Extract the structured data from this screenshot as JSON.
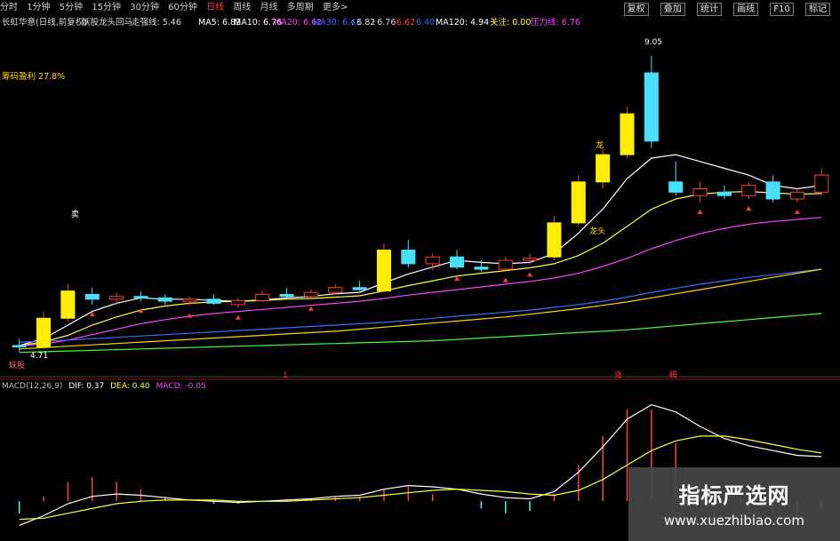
{
  "toolbar": {
    "periods": [
      "分时",
      "1分钟",
      "5分钟",
      "15分钟",
      "30分钟",
      "60分钟",
      "日线",
      "周线",
      "月线",
      "多周期",
      "更多>"
    ],
    "active": "日线",
    "buttons": [
      "复权",
      "叠加",
      "统计",
      "画线",
      "F10",
      "标记"
    ]
  },
  "info": {
    "stock": "长虹华意(日线,前复权)",
    "indicator": "妖股龙头回马",
    "lock_label": "走强线: 5.46",
    "ma5": "MA5: 6.82",
    "ma10": "MA10: 6.76",
    "ma20": "MA20: 6.62",
    "ma30": "MA30: 6.43",
    "ma_val1": ": 6.82",
    "ma_val2": ": 6.76",
    "ma_val3": "6.62",
    "ma_val4": "6.40",
    "ma120": "MA120: 4.94",
    "attention": "关注: 0.00",
    "pressure": "压力线: 6.76"
  },
  "overlay": {
    "profit": "筹码盈利 27.8%",
    "high_label": "9.05",
    "low_label": "4.71",
    "start_label": "妖股",
    "dragon1": "龙",
    "dragon2": "龙头",
    "mark_a": "涨",
    "mark_b": "腾",
    "mark_c": "1",
    "sell": "卖"
  },
  "macd": {
    "title": "MACD(12,26,9)",
    "dif": "DIF: 0.37",
    "dea": "DEA: 0.40",
    "macd": "MACD: -0.05"
  },
  "watermark": {
    "cn": "指标严选网",
    "en": "www.xuezhibiao.com"
  },
  "colors": {
    "up": "#ff3c3c",
    "down": "#49e0ff",
    "ma5": "#ffffff",
    "ma10": "#ffff40",
    "ma20": "#ff40ff",
    "ma30": "#40ff40",
    "ma60": "#3c6cff",
    "ma120": "#ffd700"
  },
  "chart_data": {
    "type": "candlestick",
    "candles": [
      {
        "o": 4.8,
        "h": 4.9,
        "l": 4.71,
        "c": 4.78
      },
      {
        "o": 4.78,
        "h": 5.3,
        "l": 4.75,
        "c": 5.2
      },
      {
        "o": 5.2,
        "h": 5.7,
        "l": 5.15,
        "c": 5.6
      },
      {
        "o": 5.55,
        "h": 5.65,
        "l": 5.4,
        "c": 5.48
      },
      {
        "o": 5.48,
        "h": 5.58,
        "l": 5.4,
        "c": 5.52
      },
      {
        "o": 5.52,
        "h": 5.6,
        "l": 5.45,
        "c": 5.5
      },
      {
        "o": 5.5,
        "h": 5.55,
        "l": 5.4,
        "c": 5.45
      },
      {
        "o": 5.45,
        "h": 5.52,
        "l": 5.38,
        "c": 5.48
      },
      {
        "o": 5.48,
        "h": 5.55,
        "l": 5.4,
        "c": 5.42
      },
      {
        "o": 5.4,
        "h": 5.5,
        "l": 5.35,
        "c": 5.46
      },
      {
        "o": 5.46,
        "h": 5.6,
        "l": 5.44,
        "c": 5.55
      },
      {
        "o": 5.55,
        "h": 5.65,
        "l": 5.5,
        "c": 5.52
      },
      {
        "o": 5.52,
        "h": 5.62,
        "l": 5.48,
        "c": 5.58
      },
      {
        "o": 5.58,
        "h": 5.7,
        "l": 5.55,
        "c": 5.65
      },
      {
        "o": 5.65,
        "h": 5.75,
        "l": 5.6,
        "c": 5.62
      },
      {
        "o": 5.6,
        "h": 6.3,
        "l": 5.58,
        "c": 6.2
      },
      {
        "o": 6.2,
        "h": 6.35,
        "l": 5.95,
        "c": 6.0
      },
      {
        "o": 6.0,
        "h": 6.15,
        "l": 5.9,
        "c": 6.1
      },
      {
        "o": 6.1,
        "h": 6.2,
        "l": 5.92,
        "c": 5.95
      },
      {
        "o": 5.95,
        "h": 6.05,
        "l": 5.88,
        "c": 5.92
      },
      {
        "o": 5.92,
        "h": 6.1,
        "l": 5.9,
        "c": 6.05
      },
      {
        "o": 6.05,
        "h": 6.15,
        "l": 5.98,
        "c": 6.08
      },
      {
        "o": 6.1,
        "h": 6.7,
        "l": 6.05,
        "c": 6.6
      },
      {
        "o": 6.6,
        "h": 7.3,
        "l": 6.55,
        "c": 7.2
      },
      {
        "o": 7.2,
        "h": 7.7,
        "l": 7.1,
        "c": 7.6
      },
      {
        "o": 7.6,
        "h": 8.3,
        "l": 7.55,
        "c": 8.2
      },
      {
        "o": 8.8,
        "h": 9.05,
        "l": 7.7,
        "c": 7.8
      },
      {
        "o": 7.2,
        "h": 7.5,
        "l": 7.0,
        "c": 7.05
      },
      {
        "o": 7.0,
        "h": 7.2,
        "l": 6.9,
        "c": 7.1
      },
      {
        "o": 7.05,
        "h": 7.15,
        "l": 6.95,
        "c": 7.0
      },
      {
        "o": 7.0,
        "h": 7.2,
        "l": 6.95,
        "c": 7.15
      },
      {
        "o": 7.2,
        "h": 7.3,
        "l": 6.9,
        "c": 6.95
      },
      {
        "o": 6.95,
        "h": 7.1,
        "l": 6.9,
        "c": 7.05
      },
      {
        "o": 7.05,
        "h": 7.4,
        "l": 7.0,
        "c": 7.3
      }
    ],
    "ma_series": [
      {
        "key": "ma5",
        "values": [
          4.8,
          4.9,
          5.1,
          5.3,
          5.42,
          5.5,
          5.48,
          5.48,
          5.46,
          5.45,
          5.47,
          5.5,
          5.52,
          5.56,
          5.58,
          5.72,
          5.85,
          5.95,
          6.05,
          6.02,
          6.0,
          6.02,
          6.15,
          6.45,
          6.8,
          7.25,
          7.55,
          7.6,
          7.5,
          7.4,
          7.3,
          7.15,
          7.1,
          7.15
        ]
      },
      {
        "key": "ma10",
        "values": [
          4.8,
          4.85,
          4.95,
          5.1,
          5.22,
          5.32,
          5.38,
          5.42,
          5.44,
          5.45,
          5.46,
          5.48,
          5.49,
          5.51,
          5.53,
          5.6,
          5.68,
          5.75,
          5.82,
          5.86,
          5.9,
          5.94,
          6.0,
          6.12,
          6.3,
          6.55,
          6.8,
          6.95,
          7.02,
          7.05,
          7.06,
          7.04,
          7.02,
          7.03
        ]
      },
      {
        "key": "ma20",
        "values": [
          4.8,
          4.82,
          4.88,
          4.96,
          5.04,
          5.12,
          5.18,
          5.23,
          5.27,
          5.3,
          5.33,
          5.36,
          5.39,
          5.42,
          5.45,
          5.49,
          5.54,
          5.58,
          5.62,
          5.66,
          5.7,
          5.74,
          5.79,
          5.86,
          5.96,
          6.08,
          6.22,
          6.34,
          6.44,
          6.52,
          6.58,
          6.62,
          6.65,
          6.68
        ]
      },
      {
        "key": "ma60",
        "values": [
          4.85,
          4.86,
          4.88,
          4.9,
          4.92,
          4.94,
          4.96,
          4.98,
          5.0,
          5.02,
          5.04,
          5.06,
          5.08,
          5.1,
          5.12,
          5.14,
          5.17,
          5.2,
          5.23,
          5.26,
          5.29,
          5.32,
          5.36,
          5.4,
          5.45,
          5.51,
          5.58,
          5.64,
          5.7,
          5.75,
          5.8,
          5.84,
          5.88,
          5.92
        ]
      },
      {
        "key": "ma120",
        "values": [
          4.75,
          4.77,
          4.79,
          4.81,
          4.83,
          4.85,
          4.87,
          4.89,
          4.91,
          4.93,
          4.95,
          4.97,
          4.99,
          5.01,
          5.04,
          5.07,
          5.1,
          5.13,
          5.16,
          5.19,
          5.22,
          5.26,
          5.3,
          5.34,
          5.39,
          5.44,
          5.5,
          5.56,
          5.62,
          5.68,
          5.74,
          5.8,
          5.86,
          5.92
        ]
      },
      {
        "key": "ma30",
        "values": [
          4.7,
          4.71,
          4.72,
          4.73,
          4.74,
          4.75,
          4.76,
          4.77,
          4.78,
          4.79,
          4.8,
          4.81,
          4.82,
          4.83,
          4.84,
          4.85,
          4.86,
          4.87,
          4.89,
          4.91,
          4.93,
          4.95,
          4.97,
          4.99,
          5.01,
          5.03,
          5.06,
          5.09,
          5.12,
          5.15,
          5.18,
          5.21,
          5.24,
          5.27
        ]
      }
    ],
    "ylim": [
      4.5,
      9.4
    ],
    "macd_dif": [
      -0.2,
      -0.12,
      -0.02,
      0.04,
      0.06,
      0.05,
      0.03,
      0.01,
      0.0,
      -0.01,
      0.0,
      0.01,
      0.02,
      0.04,
      0.05,
      0.1,
      0.13,
      0.12,
      0.1,
      0.06,
      0.03,
      0.02,
      0.08,
      0.24,
      0.45,
      0.68,
      0.8,
      0.74,
      0.62,
      0.52,
      0.46,
      0.42,
      0.38,
      0.37
    ],
    "macd_dea": [
      -0.15,
      -0.14,
      -0.1,
      -0.06,
      -0.02,
      0.0,
      0.01,
      0.01,
      0.01,
      0.0,
      0.0,
      0.0,
      0.01,
      0.02,
      0.03,
      0.05,
      0.07,
      0.09,
      0.1,
      0.09,
      0.08,
      0.06,
      0.05,
      0.09,
      0.18,
      0.3,
      0.42,
      0.5,
      0.54,
      0.54,
      0.51,
      0.47,
      0.43,
      0.4
    ],
    "macd_ylim": [
      -0.3,
      0.9
    ]
  }
}
